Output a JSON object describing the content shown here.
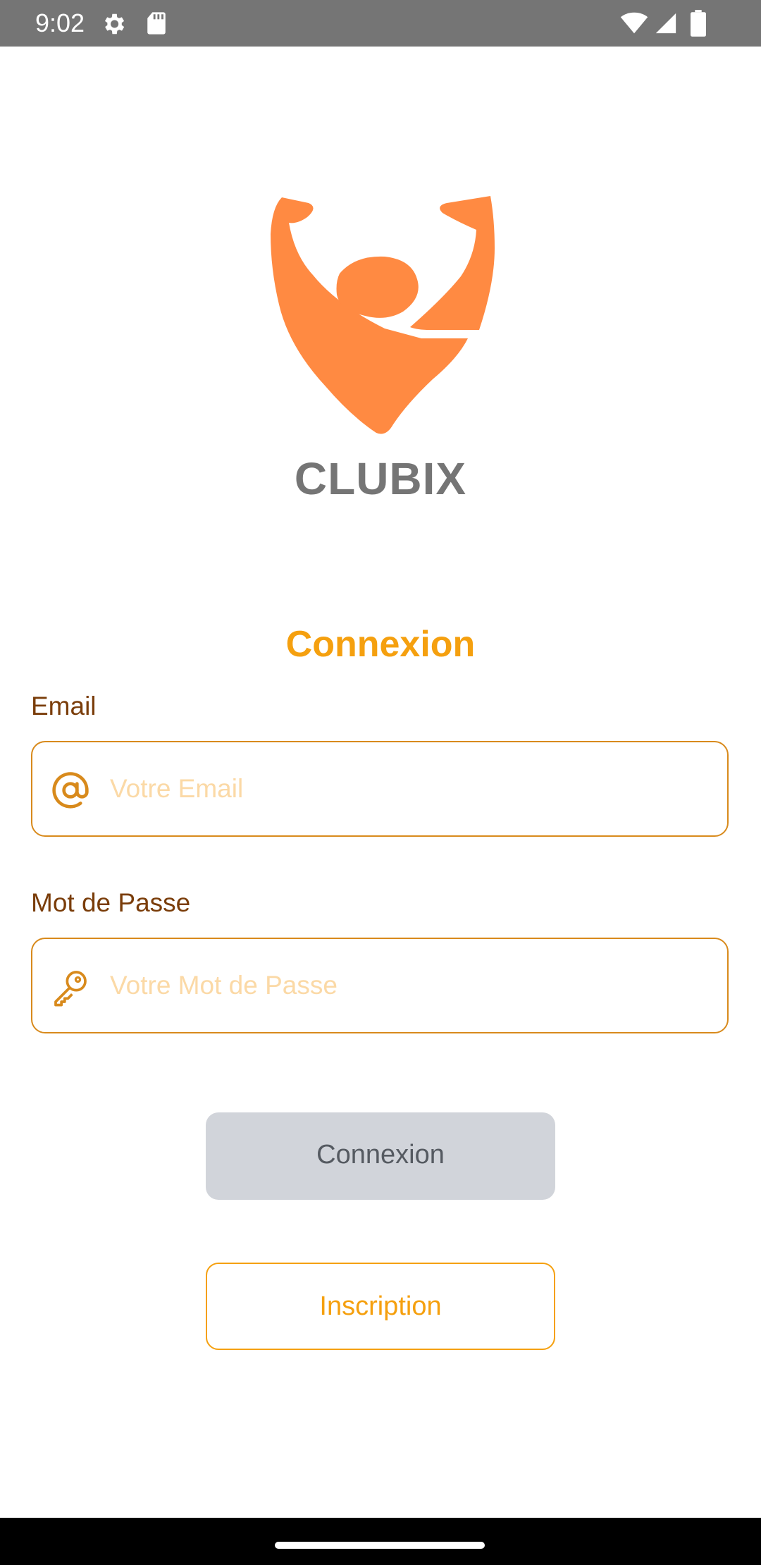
{
  "status_bar": {
    "time": "9:02",
    "left_icons": [
      "settings-gear-icon",
      "sd-card-icon"
    ],
    "right_icons": [
      "wifi-icon",
      "signal-icon",
      "battery-icon"
    ]
  },
  "app": {
    "name": "CLUBIX",
    "logo_icon": "clubix-logo-icon",
    "accent_color": "#f5a00f",
    "logo_color": "#ff8a42"
  },
  "login": {
    "title": "Connexion",
    "email": {
      "label": "Email",
      "placeholder": "Votre Email",
      "value": "",
      "icon": "at-sign-icon"
    },
    "password": {
      "label": "Mot de Passe",
      "placeholder": "Votre Mot de Passe",
      "value": "",
      "icon": "key-icon"
    },
    "login_button": "Connexion",
    "register_button": "Inscription"
  }
}
